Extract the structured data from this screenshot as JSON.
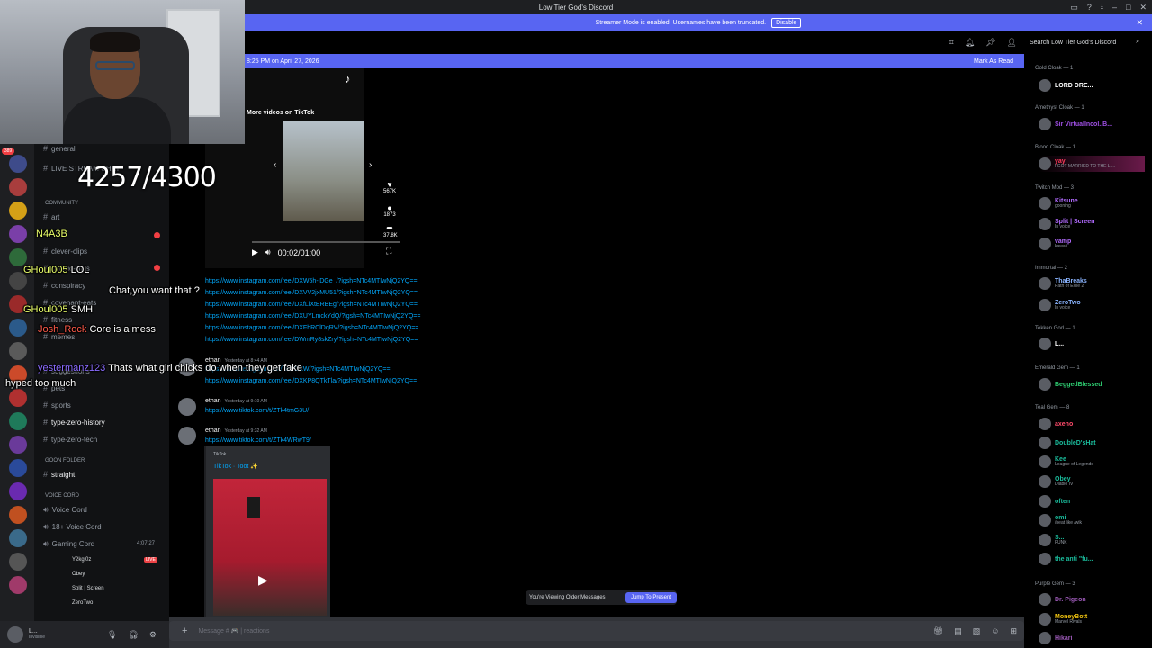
{
  "window": {
    "title": "Low Tier God's Discord"
  },
  "streamer_bar": {
    "text": "Streamer Mode is enabled. Usernames have been truncated.",
    "button": "Disable",
    "close": "✕"
  },
  "search": {
    "placeholder": "Search Low Tier God's Discord"
  },
  "divider": {
    "date": "8:25 PM on April 27, 2026",
    "mark_read": "Mark As Read"
  },
  "overlay": {
    "counter": "4257/4300",
    "chat": [
      {
        "user": "N4A3B",
        "text": ""
      },
      {
        "user": "GHoul005",
        "text": "LOL"
      },
      {
        "user": "",
        "text": "Chat,you want that ?"
      },
      {
        "user": "GHoul005",
        "text": "SMH"
      },
      {
        "user": "Josh_Rock",
        "text": "Core is a mess"
      },
      {
        "user": "yestermanz123",
        "text": "Thats what girl chicks do when they get fake"
      },
      {
        "user": "",
        "text": "hyped too much"
      }
    ]
  },
  "channels": {
    "items": [
      {
        "label": "general"
      },
      {
        "label": "LIVE STREAM CHAT"
      },
      {
        "label": "COMMUNITY"
      },
      {
        "label": "art"
      },
      {
        "label": "clever-clips"
      },
      {
        "label": "classic-clips"
      },
      {
        "label": "conspiracy"
      },
      {
        "label": "covenant-eats"
      },
      {
        "label": "fitness"
      },
      {
        "label": "memes"
      },
      {
        "label": "suggestions"
      },
      {
        "label": "pets"
      },
      {
        "label": "sports"
      },
      {
        "label": "type-zero-history"
      },
      {
        "label": "type-zero-tech"
      },
      {
        "label": "GOON FOLDER"
      },
      {
        "label": "straight"
      },
      {
        "label": "VOICE CORD"
      },
      {
        "label": "Voice Cord"
      },
      {
        "label": "18+ Voice Cord"
      },
      {
        "label": "Gaming Cord"
      }
    ],
    "gaming_timer": "4:07:27",
    "voice_users": [
      "Y2kgl0z",
      "Obey",
      "Split | Screen",
      "ZeroTwo"
    ],
    "live_label": "LIVE"
  },
  "user": {
    "name": "L...",
    "status": "Invisible"
  },
  "tiktok": {
    "more": "More videos on TikTok",
    "time": "00:02/01:00",
    "likes": "567K",
    "comments": "1873",
    "shares": "37.8K"
  },
  "links": [
    "https://www.instagram.com/reel/DXW5h-lDGe_/?igsh=NTc4MTIwNjQ2YQ==",
    "https://www.instagram.com/reel/DXVV2jxMU51/?igsh=NTc4MTIwNjQ2YQ==",
    "https://www.instagram.com/reel/DXfLlXtERBEg/?igsh=NTc4MTIwNjQ2YQ==",
    "https://www.instagram.com/reel/DXUYLmckYdQ/?igsh=NTc4MTIwNjQ2YQ==",
    "https://www.instagram.com/reel/DXFhRClDqRV/?igsh=NTc4MTIwNjQ2YQ==",
    "https://www.instagram.com/reel/DWmRy8skZry/?igsh=NTc4MTIwNjQ2YQ=="
  ],
  "messages": [
    {
      "author": "ethan",
      "time": "Yesterday at 8:44 AM",
      "links": [
        "https://www.instagram.com/reel/DXW/?igsh=NTc4MTIwNjQ2YQ==",
        "https://www.instagram.com/reel/DXKP8QTkTla/?igsh=NTc4MTIwNjQ2YQ=="
      ]
    },
    {
      "author": "ethan",
      "time": "Yesterday at 9:10 AM",
      "links": [
        "https://www.tiktok.com/t/ZTk4tmG3U/"
      ]
    },
    {
      "author": "ethan",
      "time": "Yesterday at 9:32 AM",
      "links": [
        "https://www.tiktok.com/t/ZTk4WRwT9/"
      ]
    }
  ],
  "embed": {
    "provider": "TikTok",
    "title": "TikTok · Toot ✨"
  },
  "older": {
    "text": "You're Viewing Older Messages",
    "button": "Jump To Present"
  },
  "composer": {
    "placeholder": "Message # 🎮 | reactions"
  },
  "members": [
    {
      "role": "Gold Cloak — 1",
      "users": [
        {
          "name": "LORD DRE...",
          "sub": "",
          "color": "#ffffff"
        }
      ]
    },
    {
      "role": "Amethyst Cloak — 1",
      "users": [
        {
          "name": "Sir VirtualIncol..B...",
          "sub": "",
          "color": "#a050e6"
        }
      ]
    },
    {
      "role": "Blood Cloak — 1",
      "users": [
        {
          "name": "yay",
          "sub": "I GOT MARRIED TO THE LI...",
          "color": "#ff3b5c"
        }
      ]
    },
    {
      "role": "Twitch Mod — 3",
      "users": [
        {
          "name": "Kitsune",
          "sub": "gooning",
          "color": "#b26bff"
        },
        {
          "name": "Split | Screen",
          "sub": "In voice",
          "color": "#b26bff"
        },
        {
          "name": "vamp",
          "sub": "kawaii",
          "color": "#b26bff"
        }
      ]
    },
    {
      "role": "Immortal — 2",
      "users": [
        {
          "name": "ThaBreaks",
          "sub": "Path of Exile 2",
          "color": "#8ab4ff"
        },
        {
          "name": "ZeroTwo",
          "sub": "In voice",
          "color": "#8ab4ff"
        }
      ]
    },
    {
      "role": "Tekken God — 1",
      "users": [
        {
          "name": "L...",
          "sub": "",
          "color": "#ffffff"
        }
      ]
    },
    {
      "role": "Emerald Gem — 1",
      "users": [
        {
          "name": "BeggedBlessed",
          "sub": "",
          "color": "#2ecc71"
        }
      ]
    },
    {
      "role": "Teal Gem — 8",
      "users": [
        {
          "name": "axeno",
          "sub": "",
          "color": "#1abc9c"
        },
        {
          "name": "DoubleD'sHat",
          "sub": "",
          "color": "#1abc9c"
        },
        {
          "name": "Kee",
          "sub": "League of Legends",
          "color": "#1abc9c"
        },
        {
          "name": "Obey",
          "sub": "Diablo IV",
          "color": "#1abc9c"
        },
        {
          "name": "often",
          "sub": "",
          "color": "#1abc9c"
        },
        {
          "name": "omi",
          "sub": "/neat like /wik",
          "color": "#1abc9c"
        },
        {
          "name": "S...",
          "sub": "FUNK",
          "color": "#1abc9c"
        },
        {
          "name": "the anti \"fu...",
          "sub": "",
          "color": "#1abc9c"
        }
      ]
    },
    {
      "role": "Purple Gem — 3",
      "users": [
        {
          "name": "Dr. Pigeon",
          "sub": "",
          "color": "#9b59b6"
        },
        {
          "name": "MoneyBott",
          "sub": "Marvel Rivals",
          "color": "#f1c40f"
        },
        {
          "name": "Hikari",
          "sub": "",
          "color": "#9b59b6"
        }
      ]
    }
  ]
}
